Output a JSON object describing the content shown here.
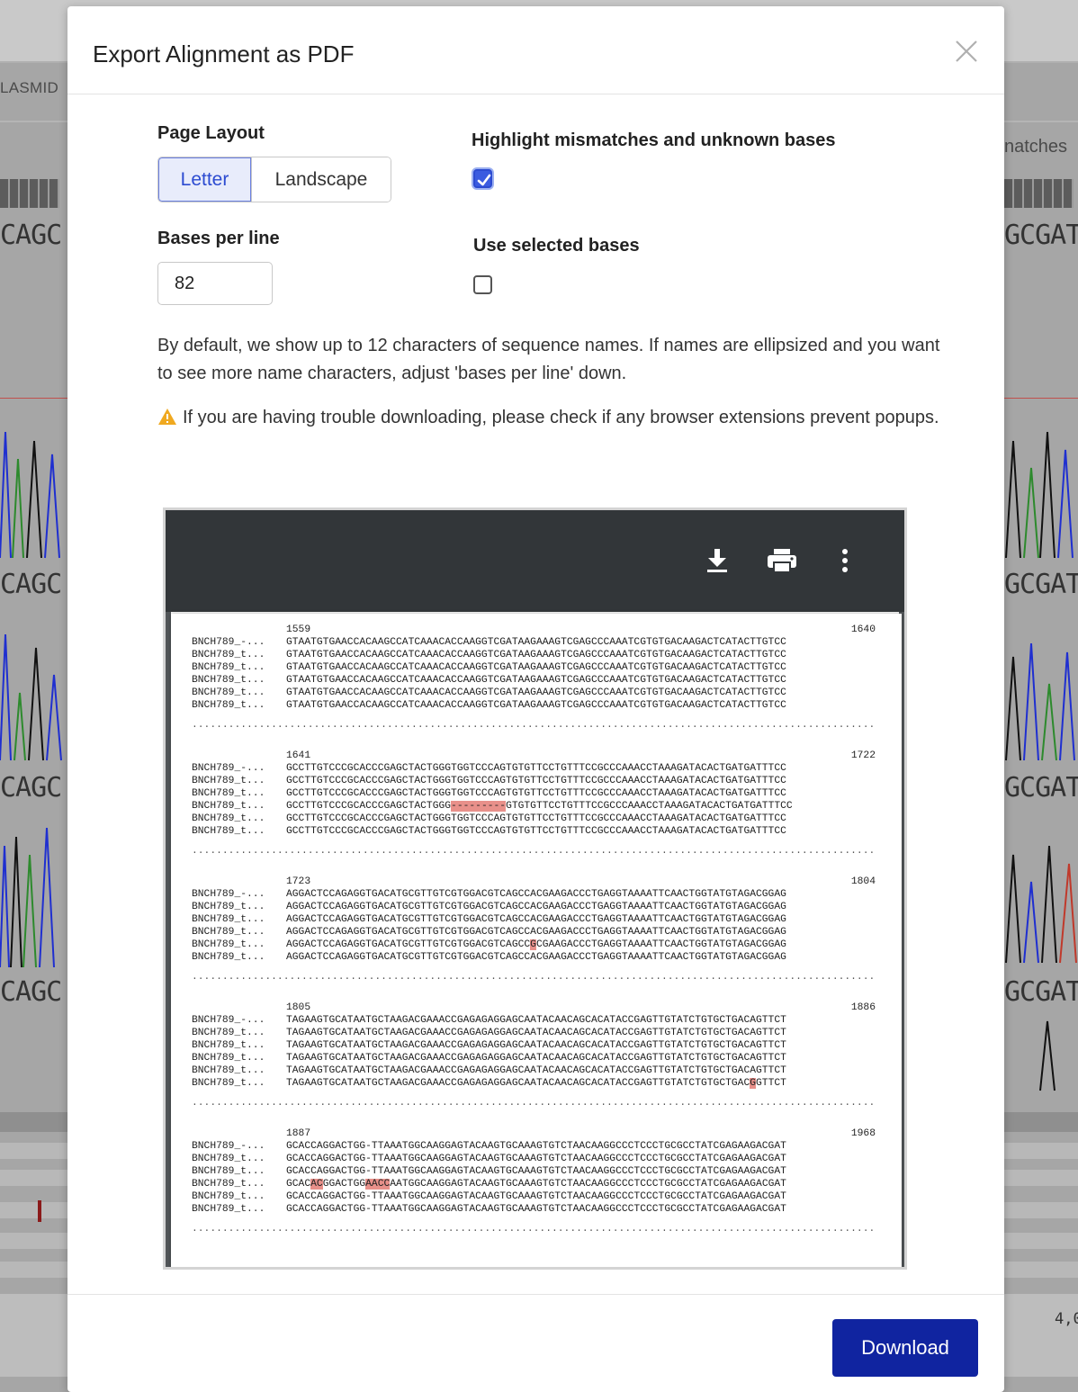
{
  "background": {
    "left_tab": "LASMID",
    "right_tab": "natches",
    "seq_left": "CAGC",
    "seq_right": "GCGAT",
    "corner_number": "4,0"
  },
  "modal": {
    "title": "Export Alignment as PDF",
    "close_icon": "close-icon",
    "page_layout": {
      "label": "Page Layout",
      "options": [
        "Letter",
        "Landscape"
      ],
      "selected": "Letter"
    },
    "highlight": {
      "label": "Highlight mismatches and unknown bases",
      "checked": true
    },
    "bases_per_line": {
      "label": "Bases per line",
      "value": "82"
    },
    "use_selected": {
      "label": "Use selected bases",
      "checked": false
    },
    "info_text": "By default, we show up to 12 characters of sequence names. If names are ellipsized and you want to see more name characters, adjust 'bases per line' down.",
    "warning_text": "If you are having trouble downloading, please check if any browser extensions prevent popups.",
    "download_label": "Download"
  },
  "preview": {
    "toolbar_icons": [
      "download-icon",
      "print-icon",
      "more-vert-icon"
    ],
    "names": [
      "BNCH789_-...",
      "BNCH789_t...",
      "BNCH789_t...",
      "BNCH789_t...",
      "BNCH789_t...",
      "BNCH789_t..."
    ],
    "dots": "..............................................................................................................................................",
    "blocks": [
      {
        "start": "1559",
        "end": "1640",
        "rows": [
          [
            "GTAATGTGAACCACAAGCCATCAAACACCAAGGTCGATAAGAAAGTCGAGCCCAAATCGTGTGACAAGACTCATACTTGTCC"
          ],
          [
            "GTAATGTGAACCACAAGCCATCAAACACCAAGGTCGATAAGAAAGTCGAGCCCAAATCGTGTGACAAGACTCATACTTGTCC"
          ],
          [
            "GTAATGTGAACCACAAGCCATCAAACACCAAGGTCGATAAGAAAGTCGAGCCCAAATCGTGTGACAAGACTCATACTTGTCC"
          ],
          [
            "GTAATGTGAACCACAAGCCATCAAACACCAAGGTCGATAAGAAAGTCGAGCCCAAATCGTGTGACAAGACTCATACTTGTCC"
          ],
          [
            "GTAATGTGAACCACAAGCCATCAAACACCAAGGTCGATAAGAAAGTCGAGCCCAAATCGTGTGACAAGACTCATACTTGTCC"
          ],
          [
            "GTAATGTGAACCACAAGCCATCAAACACCAAGGTCGATAAGAAAGTCGAGCCCAAATCGTGTGACAAGACTCATACTTGTCC"
          ]
        ]
      },
      {
        "start": "1641",
        "end": "1722",
        "rows": [
          [
            "GCCTTGTCCCGCACCCGAGCTACTGGGTGGTCCCAGTGTGTTCCTGTTTCCGCCCAAACCTAAAGATACACTGATGATTTCC"
          ],
          [
            "GCCTTGTCCCGCACCCGAGCTACTGGGTGGTCCCAGTGTGTTCCTGTTTCCGCCCAAACCTAAAGATACACTGATGATTTCC"
          ],
          [
            "GCCTTGTCCCGCACCCGAGCTACTGGGTGGTCCCAGTGTGTTCCTGTTTCCGCCCAAACCTAAAGATACACTGATGATTTCC"
          ],
          [
            "GCCTTGTCCCGCACCCGAGCTACTGGG",
            "---------",
            "GTGTGTTCCTGTTTCCGCCCAAACCTAAAGATACACTGATGATTTCC"
          ],
          [
            "GCCTTGTCCCGCACCCGAGCTACTGGGTGGTCCCAGTGTGTTCCTGTTTCCGCCCAAACCTAAAGATACACTGATGATTTCC"
          ],
          [
            "GCCTTGTCCCGCACCCGAGCTACTGGGTGGTCCCAGTGTGTTCCTGTTTCCGCCCAAACCTAAAGATACACTGATGATTTCC"
          ]
        ]
      },
      {
        "start": "1723",
        "end": "1804",
        "rows": [
          [
            "AGGACTCCAGAGGTGACATGCGTTGTCGTGGACGTCAGCCACGAAGACCCTGAGGTAAAATTCAACTGGTATGTAGACGGAG"
          ],
          [
            "AGGACTCCAGAGGTGACATGCGTTGTCGTGGACGTCAGCCACGAAGACCCTGAGGTAAAATTCAACTGGTATGTAGACGGAG"
          ],
          [
            "AGGACTCCAGAGGTGACATGCGTTGTCGTGGACGTCAGCCACGAAGACCCTGAGGTAAAATTCAACTGGTATGTAGACGGAG"
          ],
          [
            "AGGACTCCAGAGGTGACATGCGTTGTCGTGGACGTCAGCCACGAAGACCCTGAGGTAAAATTCAACTGGTATGTAGACGGAG"
          ],
          [
            "AGGACTCCAGAGGTGACATGCGTTGTCGTGGACGTCAGCC",
            "G",
            "CGAAGACCCTGAGGTAAAATTCAACTGGTATGTAGACGGAG"
          ],
          [
            "AGGACTCCAGAGGTGACATGCGTTGTCGTGGACGTCAGCCACGAAGACCCTGAGGTAAAATTCAACTGGTATGTAGACGGAG"
          ]
        ]
      },
      {
        "start": "1805",
        "end": "1886",
        "rows": [
          [
            "TAGAAGTGCATAATGCTAAGACGAAACCGAGAGAGGAGCAATACAACAGCACATACCGAGTTGTATCTGTGCTGACAGTTCT"
          ],
          [
            "TAGAAGTGCATAATGCTAAGACGAAACCGAGAGAGGAGCAATACAACAGCACATACCGAGTTGTATCTGTGCTGACAGTTCT"
          ],
          [
            "TAGAAGTGCATAATGCTAAGACGAAACCGAGAGAGGAGCAATACAACAGCACATACCGAGTTGTATCTGTGCTGACAGTTCT"
          ],
          [
            "TAGAAGTGCATAATGCTAAGACGAAACCGAGAGAGGAGCAATACAACAGCACATACCGAGTTGTATCTGTGCTGACAGTTCT"
          ],
          [
            "TAGAAGTGCATAATGCTAAGACGAAACCGAGAGAGGAGCAATACAACAGCACATACCGAGTTGTATCTGTGCTGACAGTTCT"
          ],
          [
            "TAGAAGTGCATAATGCTAAGACGAAACCGAGAGAGGAGCAATACAACAGCACATACCGAGTTGTATCTGTGCTGAC",
            "G",
            "GTTCT"
          ]
        ]
      },
      {
        "start": "1887",
        "end": "1968",
        "rows": [
          [
            "GCACCAGGACTGG-TTAAATGGCAAGGAGTACAAGTGCAAAGTGTCTAACAAGGCCCTCCCTGCGCCTATCGAGAAGACGAT"
          ],
          [
            "GCACCAGGACTGG-TTAAATGGCAAGGAGTACAAGTGCAAAGTGTCTAACAAGGCCCTCCCTGCGCCTATCGAGAAGACGAT"
          ],
          [
            "GCACCAGGACTGG-TTAAATGGCAAGGAGTACAAGTGCAAAGTGTCTAACAAGGCCCTCCCTGCGCCTATCGAGAAGACGAT"
          ],
          [
            "GCAC",
            "AC",
            "GGACTGG",
            "AACC",
            "AATGGCAAGGAGTACAAGTGCAAAGTGTCTAACAAGGCCCTCCCTGCGCCTATCGAGAAGACGAT"
          ],
          [
            "GCACCAGGACTGG-TTAAATGGCAAGGAGTACAAGTGCAAAGTGTCTAACAAGGCCCTCCCTGCGCCTATCGAGAAGACGAT"
          ],
          [
            "GCACCAGGACTGG-TTAAATGGCAAGGAGTACAAGTGCAAAGTGTCTAACAAGGCCCTCCCTGCGCCTATCGAGAAGACGAT"
          ]
        ]
      }
    ]
  },
  "colors": {
    "accent": "#2c4bd1",
    "download_bg": "#1024a0",
    "mismatch_highlight": "#e8908a",
    "toolbar_bg": "#323639"
  }
}
